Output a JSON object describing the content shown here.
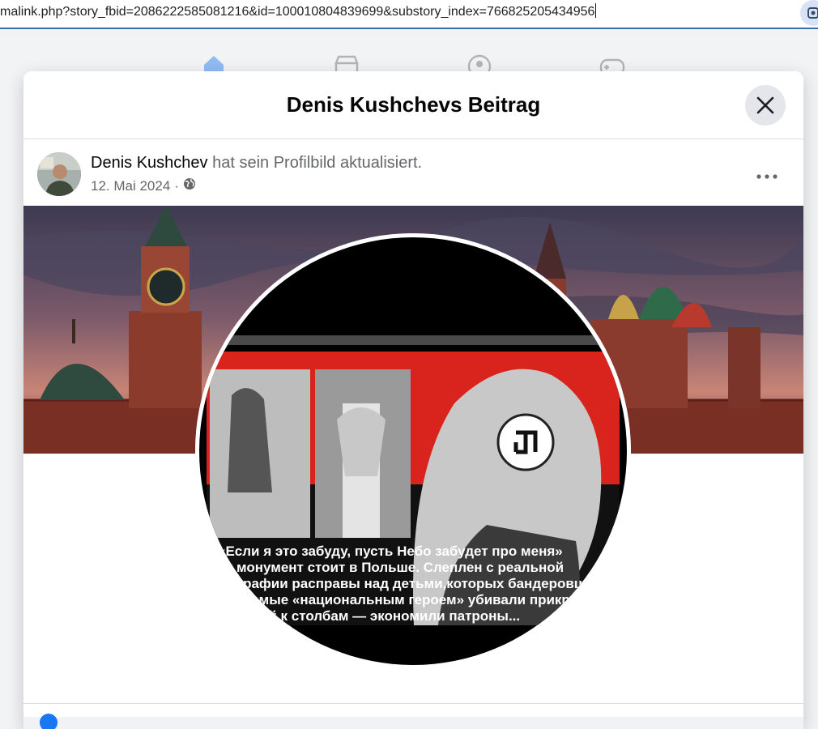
{
  "browser": {
    "url": "malink.php?story_fbid=2086222585081216&id=100010804839699&substory_index=766825205434956"
  },
  "nav": {
    "icons": [
      "home-icon",
      "marketplace-icon",
      "groups-icon",
      "gaming-icon"
    ]
  },
  "modal": {
    "title": "Denis Kushchevs Beitrag"
  },
  "post": {
    "author": "Denis Kushchev",
    "action": "hat sein Profilbild aktualisiert.",
    "date": "12. Mai 2024",
    "separator": "·",
    "visibility_icon": "globe-icon"
  },
  "profile_image": {
    "caption_lines": [
      "«Если я это забуду, пусть Небо забудет про меня»",
      "от монумент стоит в Польше. Слеплен с реальной",
      "графии расправы над детьми,которых бандеровцы",
      "аемые «национальным героем» убивали прикручи",
      "ой к столбам — экономили патроны..."
    ]
  },
  "colors": {
    "accent": "#1877f2",
    "modal_bg": "#ffffff",
    "page_bg": "#f0f2f5",
    "poster_red": "#d8241d"
  }
}
